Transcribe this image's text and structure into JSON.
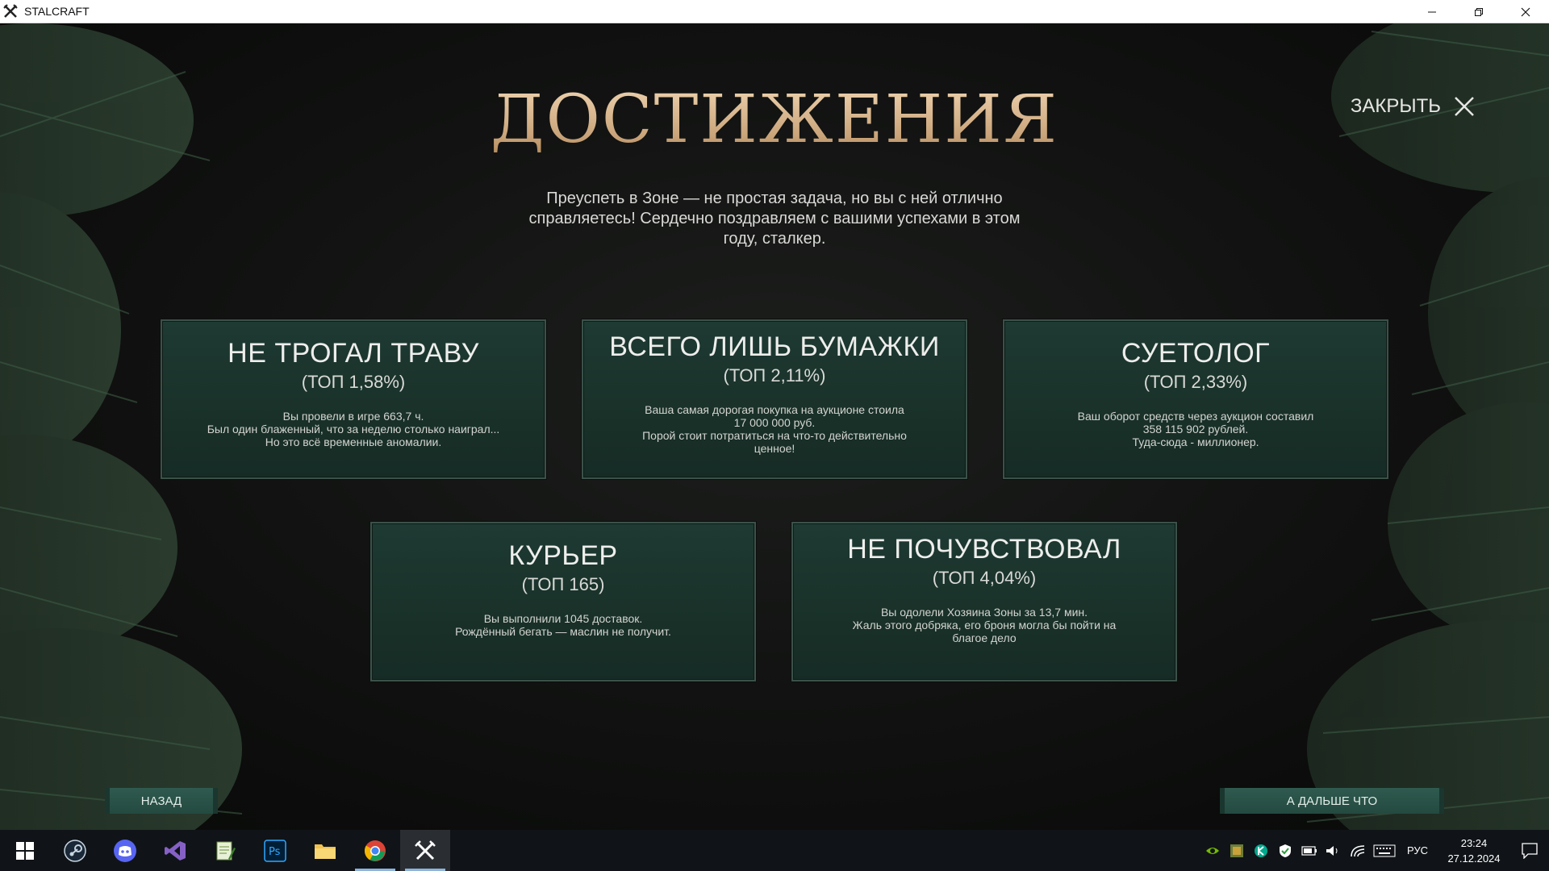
{
  "window": {
    "title": "STALCRAFT"
  },
  "header": {
    "title": "ДОСТИЖЕНИЯ",
    "subtitle_lines": [
      "Преуспеть в Зоне — не простая задача, но вы с ней отлично",
      "справляетесь! Сердечно поздравляем с вашими успехами в этом",
      "году, сталкер."
    ],
    "close_label": "ЗАКРЫТЬ"
  },
  "cards": [
    {
      "title": "НЕ ТРОГАЛ ТРАВУ",
      "rank": "(ТОП 1,58%)",
      "desc": [
        "Вы провели в игре 663,7 ч.",
        "Был один блаженный, что за неделю столько наиграл...",
        "Но это всё временные аномалии."
      ]
    },
    {
      "title": "ВСЕГО ЛИШЬ БУМАЖКИ",
      "rank": "(ТОП 2,11%)",
      "desc": [
        "Ваша самая дорогая покупка на аукционе стоила",
        "17 000 000 руб.",
        "Порой стоит потратиться на что-то действительно",
        "ценное!"
      ]
    },
    {
      "title": "СУЕТОЛОГ",
      "rank": "(ТОП 2,33%)",
      "desc": [
        "Ваш оборот средств через аукцион составил",
        "358 115 902 рублей.",
        "Туда-сюда - миллионер."
      ]
    },
    {
      "title": "КУРЬЕР",
      "rank": "(ТОП 165)",
      "desc": [
        "Вы выполнили 1045 доставок.",
        "Рождённый бегать — маслин не получит."
      ]
    },
    {
      "title": "НЕ ПОЧУВСТВОВАЛ",
      "rank": "(ТОП 4,04%)",
      "desc": [
        "Вы одолели Хозяина Зоны за 13,7 мин.",
        "Жаль этого добряка, его броня могла бы пойти на",
        "благое дело"
      ]
    }
  ],
  "footer": {
    "back_label": "НАЗАД",
    "next_label": "А ДАЛЬШЕ ЧТО"
  },
  "taskbar": {
    "apps": [
      "windows-start-icon",
      "steam-icon",
      "discord-icon",
      "visual-studio-icon",
      "notepad-icon",
      "photoshop-icon",
      "file-explorer-icon",
      "chrome-icon",
      "stalcraft-icon"
    ],
    "photoshop_label": "Ps",
    "language": "РУС",
    "time": "23:24",
    "date": "27.12.2024"
  }
}
